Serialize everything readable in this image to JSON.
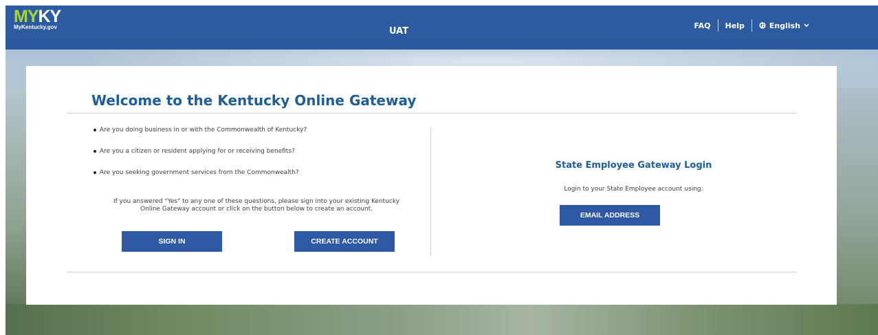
{
  "header": {
    "logo_my": "MY",
    "logo_ky": "KY",
    "logo_sub": "MyKentucky.gov",
    "environment": "UAT",
    "nav": {
      "faq": "FAQ",
      "help": "Help",
      "language": "English"
    }
  },
  "welcome": {
    "title": "Welcome to the Kentucky Online Gateway",
    "questions": [
      "Are you doing business in or with the Commonwealth of Kentucky?",
      "Are you a citizen or resident applying for or receiving benefits?",
      "Are you seeking government services from the Commonwealth?"
    ],
    "note_line1": "If you answered \"Yes\" to any one of these questions, please sign into your existing Kentucky",
    "note_line2": "Online Gateway account or click on the button below to create an account.",
    "sign_in_label": "SIGN IN",
    "create_account_label": "CREATE ACCOUNT"
  },
  "employee": {
    "title": "State Employee Gateway Login",
    "subtitle": "Login to your State Employee account using:",
    "email_button_label": "EMAIL ADDRESS"
  },
  "colors": {
    "header_bg": "#2d5da0",
    "logo_accent": "#a6d63a",
    "title_blue": "#1d5e98",
    "button_bg": "#2d59a5"
  },
  "icons": {
    "language": "globe-icon",
    "dropdown": "chevron-down-icon"
  }
}
